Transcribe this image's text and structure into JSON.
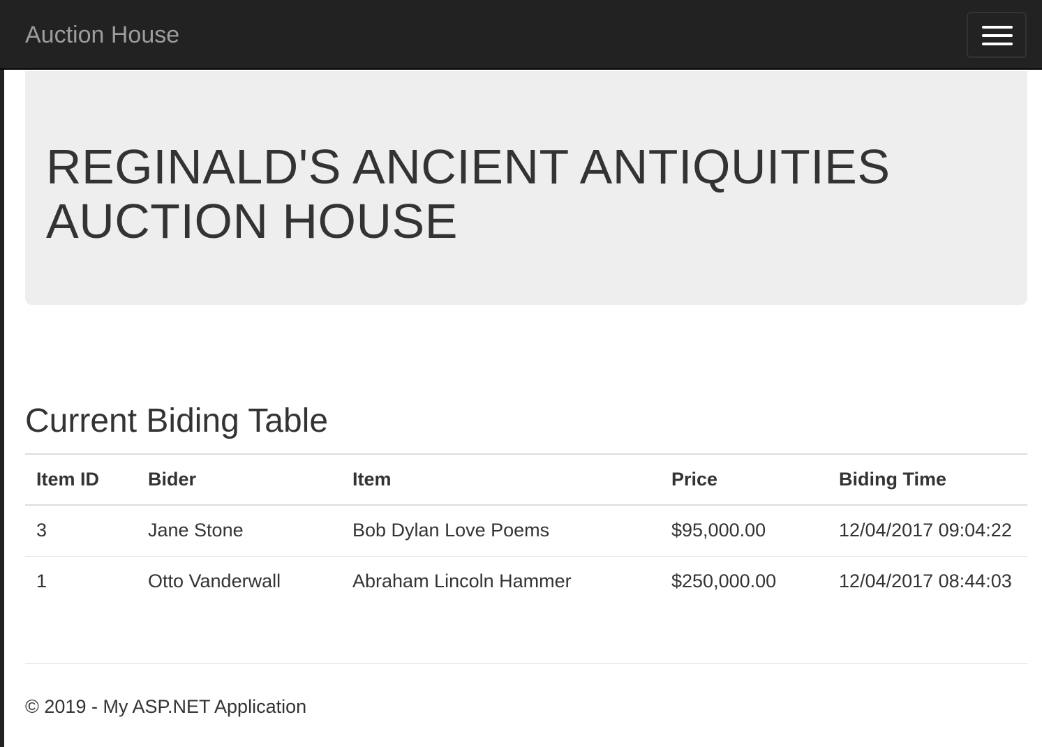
{
  "navbar": {
    "brand": "Auction House",
    "toggle_icon": "hamburger-menu-icon"
  },
  "jumbotron": {
    "title_line1": "REGINALD'S ANCIENT ANTIQUITIES",
    "title_line2": "AUCTION HOUSE"
  },
  "bids": {
    "title": "Current Biding Table",
    "columns": [
      "Item ID",
      "Bider",
      "Item",
      "Price",
      "Biding Time"
    ],
    "rows": [
      {
        "item_id": "3",
        "bider": "Jane Stone",
        "item": "Bob Dylan Love Poems",
        "price": "$95,000.00",
        "time": "12/04/2017 09:04:22"
      },
      {
        "item_id": "1",
        "bider": "Otto Vanderwall",
        "item": "Abraham Lincoln Hammer",
        "price": "$250,000.00",
        "time": "12/04/2017 08:44:03"
      }
    ]
  },
  "footer": {
    "text": "© 2019 - My ASP.NET Application"
  },
  "colors": {
    "navbar_bg": "#222222",
    "brand_text": "#9d9d9d",
    "jumbotron_bg": "#eeeeee",
    "text": "#333333"
  }
}
